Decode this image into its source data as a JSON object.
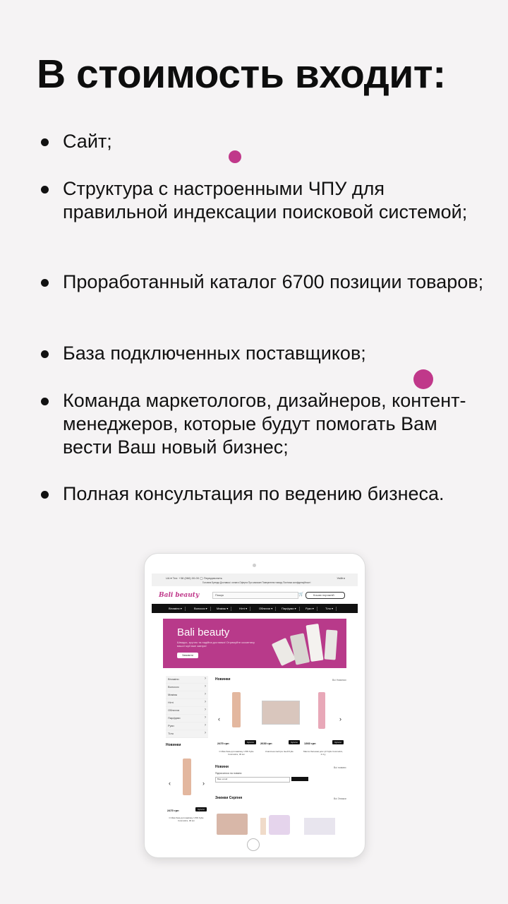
{
  "title": "В стоимость входит:",
  "bullets": [
    "Сайт;",
    "Структура с настроенными ЧПУ для правильной индексации поисковой системой;",
    "Проработанный каталог 6700 позиции товаров;",
    "База подключенных поставщиков;",
    "Команда маркетологов, дизайнеров, контент-менеджеров, которые будут помогать Вам вести Ваш новый бизнес;",
    "Полная консультация по ведению бизнеса."
  ],
  "colors": {
    "accent": "#c0388a",
    "background": "#f5f3f4",
    "text": "#111111"
  },
  "site": {
    "topbar_left": "UA  ▾  Тел: +38 (066) 00-00  ◯ Передзвонить",
    "topbar_right": "Увійти",
    "topbar_links": "Головна   Бренди   Доставка і оплата   Оферта   Про магазин   Повернення товару   Політика конфіденційності",
    "logo": "Bali beauty",
    "search_placeholder": "Пошук",
    "cart_icon": "cart-icon",
    "login_label": "Кошик порожній",
    "menu": [
      "Вітаміни ▾",
      "Волосся ▾",
      "Макіяж ▾",
      "Нігті ▾",
      "Обличчя ▾",
      "Парфуми ▾",
      "Руки ▾",
      "Тіло ▾"
    ],
    "banner_title": "Bali beauty",
    "banner_subtitle": "Швидко, зручно та надійна доставка! Отримуйте косметику вашої мрії вже завтра!",
    "banner_button": "Замовити",
    "sidebar": [
      "Вітаміни",
      "Волосся",
      "Макіяж",
      "Нігті",
      "Обличчя",
      "Парфуми",
      "Руки",
      "Тіло"
    ],
    "sidebar_section": "Новинки",
    "new_title": "Новинки",
    "see_all": "Всі Новинки",
    "products": [
      {
        "price": "2470 грн",
        "name": "Стійка база для макіяжу 1.5W Kylie Cosmetics, 30 мл",
        "buy": "Купити"
      },
      {
        "price": "2630 грн",
        "name": "Класична палітра тіней Kylie",
        "buy": "Купити"
      },
      {
        "price": "1360 грн",
        "name": "Масло-бальзам для губ Kylie Cosmetics, 2.4 g",
        "buy": "Купити"
      }
    ],
    "side_product": {
      "price": "2470 грн",
      "name": "Стійка база для макіяжу 1.5W Kylie Cosmetics, 30 мл",
      "buy": "Купити"
    },
    "news_title": "Новини",
    "news_see_all": "Всі новини",
    "subscribe_label": "Підписатися на новини",
    "subscribe_placeholder": "Ваш email",
    "sale_title": "Знижки Серпня",
    "sale_see_all": "Всі Знижки"
  }
}
